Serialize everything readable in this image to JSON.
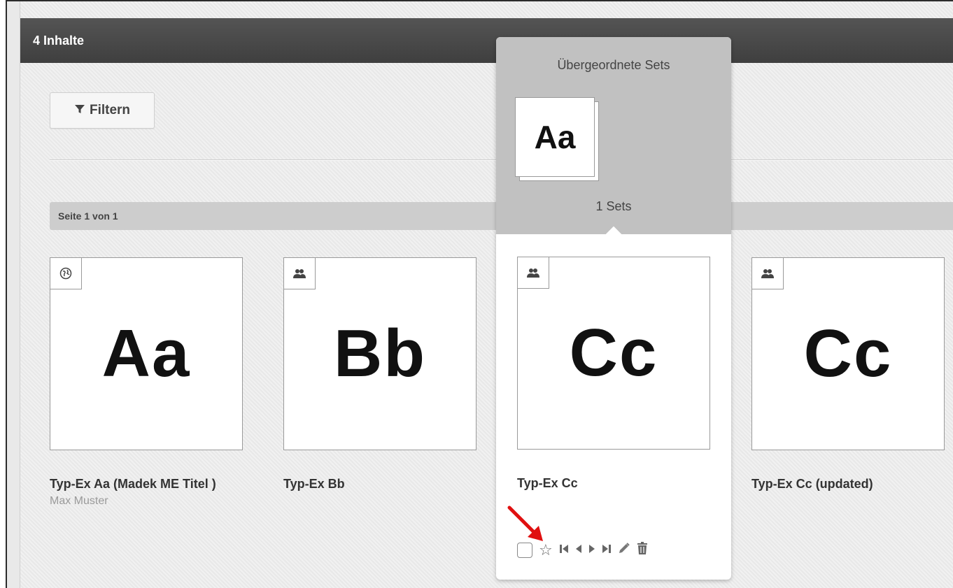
{
  "header": {
    "count_label": "4 Inhalte"
  },
  "toolbar": {
    "filter_label": "Filtern",
    "filter_icon": "filter-icon"
  },
  "pagination": {
    "label": "Seite 1 von 1"
  },
  "items": [
    {
      "thumb": "Aa",
      "title": "Typ-Ex Aa (Madek ME Titel )",
      "author": "Max Muster",
      "badge_icon": "globe-icon"
    },
    {
      "thumb": "Bb",
      "title": "Typ-Ex Bb",
      "author": "",
      "badge_icon": "group-icon"
    },
    {
      "thumb": "Cc",
      "title": "Typ-Ex Cc",
      "author": "",
      "badge_icon": "group-icon"
    },
    {
      "thumb": "Cc",
      "title": "Typ-Ex Cc (updated)",
      "author": "",
      "badge_icon": "group-icon"
    }
  ],
  "popover": {
    "title": "Übergeordnete Sets",
    "set_thumb": "Aa",
    "set_count": "1 Sets",
    "actions": [
      "checkbox",
      "star-icon",
      "first-icon",
      "prev-icon",
      "next-icon",
      "last-icon",
      "pencil-icon",
      "trash-icon"
    ]
  },
  "colors": {
    "header_bg": "#4a4a4a",
    "page_bg": "#ececec",
    "popover_head": "#c1c1c1",
    "annotation_arrow": "#e01010"
  }
}
